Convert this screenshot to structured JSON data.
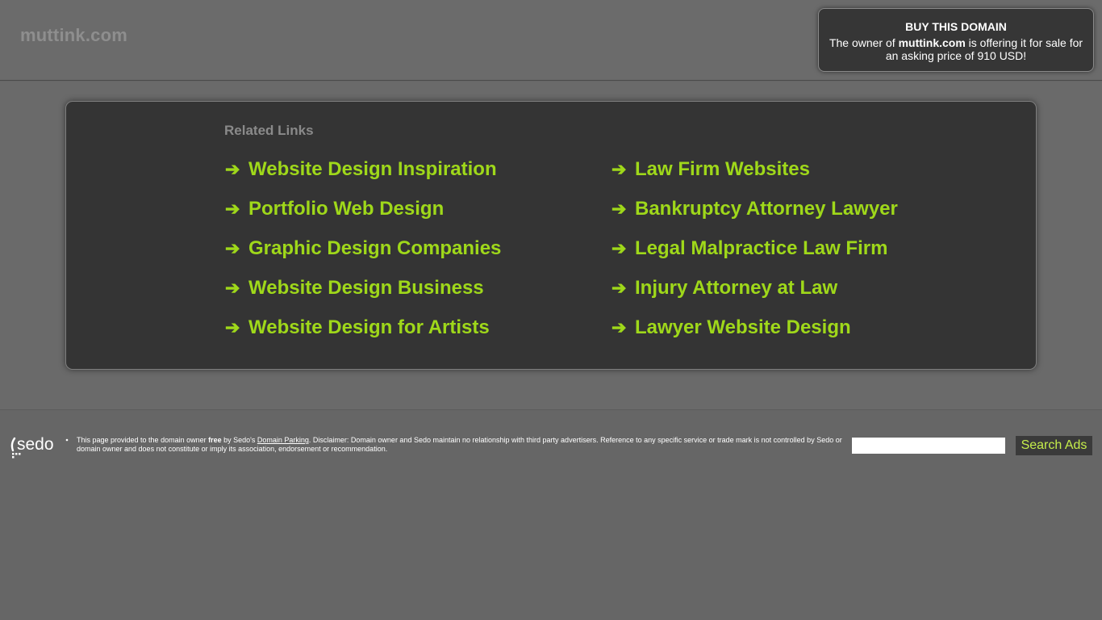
{
  "header": {
    "domain_label": "muttink.com"
  },
  "buy_box": {
    "title": "BUY THIS DOMAIN",
    "text_before": "The owner of ",
    "domain": "muttink.com",
    "text_after": " is offering it for sale for an asking price of 910 USD!"
  },
  "related": {
    "title": "Related Links",
    "arrow": "➔",
    "left_links": [
      "Website Design Inspiration",
      "Portfolio Web Design",
      "Graphic Design Companies",
      "Website Design Business",
      "Website Design for Artists"
    ],
    "right_links": [
      "Law Firm Websites",
      "Bankruptcy Attorney Lawyer",
      "Legal Malpractice Law Firm",
      "Injury Attorney at Law",
      "Lawyer Website Design"
    ]
  },
  "footer": {
    "logo_text": "sedo",
    "disclaimer_part1": "This page provided to the domain owner ",
    "disclaimer_free": "free",
    "disclaimer_part2": " by Sedo's ",
    "domain_parking_link": "Domain Parking",
    "disclaimer_part3": ". Disclaimer: Domain owner and Sedo maintain no relationship with third party advertisers. Reference to any specific service or trade mark is not controlled by Sedo or domain owner and does not constitute or imply its association, endorsement or recommendation.",
    "search_input_value": "",
    "search_button_label": "Search Ads"
  },
  "colors": {
    "background": "#666666",
    "panel": "#343434",
    "link_green": "#9fd81a",
    "button_text": "#c5ee4b"
  }
}
